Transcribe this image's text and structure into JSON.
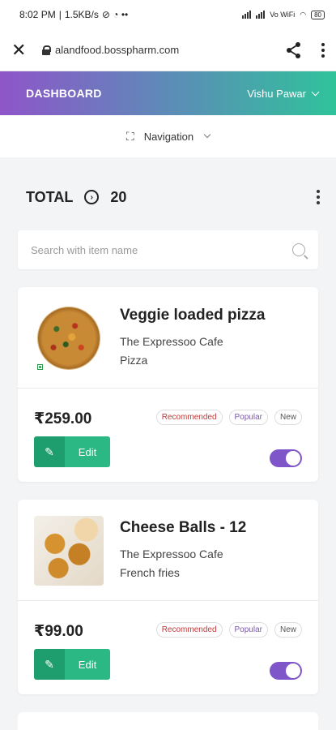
{
  "status_bar": {
    "time": "8:02 PM",
    "speed": "1.5KB/s",
    "network": "Vo WiFi",
    "battery": "80"
  },
  "browser": {
    "url": "alandfood.bosspharm.com"
  },
  "header": {
    "title": "DASHBOARD",
    "user": "Vishu Pawar"
  },
  "nav": {
    "label": "Navigation"
  },
  "summary": {
    "total_label": "TOTAL",
    "total_count": "20"
  },
  "search": {
    "placeholder": "Search with item name"
  },
  "items": [
    {
      "name": "Veggie loaded pizza",
      "cafe": "The Expressoo Cafe",
      "category": "Pizza",
      "price": "₹259.00",
      "tags": [
        "Recommended",
        "Popular",
        "New"
      ],
      "edit_label": "Edit",
      "enabled": true
    },
    {
      "name": "Cheese Balls - 12",
      "cafe": "The Expressoo Cafe",
      "category": "French fries",
      "price": "₹99.00",
      "tags": [
        "Recommended",
        "Popular",
        "New"
      ],
      "edit_label": "Edit",
      "enabled": true
    }
  ],
  "colors": {
    "header_start": "#8e55c9",
    "header_end": "#2fc39a",
    "edit_button": "#2bb884",
    "toggle_on": "#7e56c9",
    "recommended_tag": "#c23a3a",
    "popular_tag": "#7a5aa8"
  },
  "icons": [
    "close-icon",
    "lock-icon",
    "share-icon",
    "more-vert-icon",
    "chevron-down-icon",
    "navigation-icon",
    "circle-arrow-icon",
    "search-icon",
    "edit-icon",
    "veg-icon"
  ]
}
